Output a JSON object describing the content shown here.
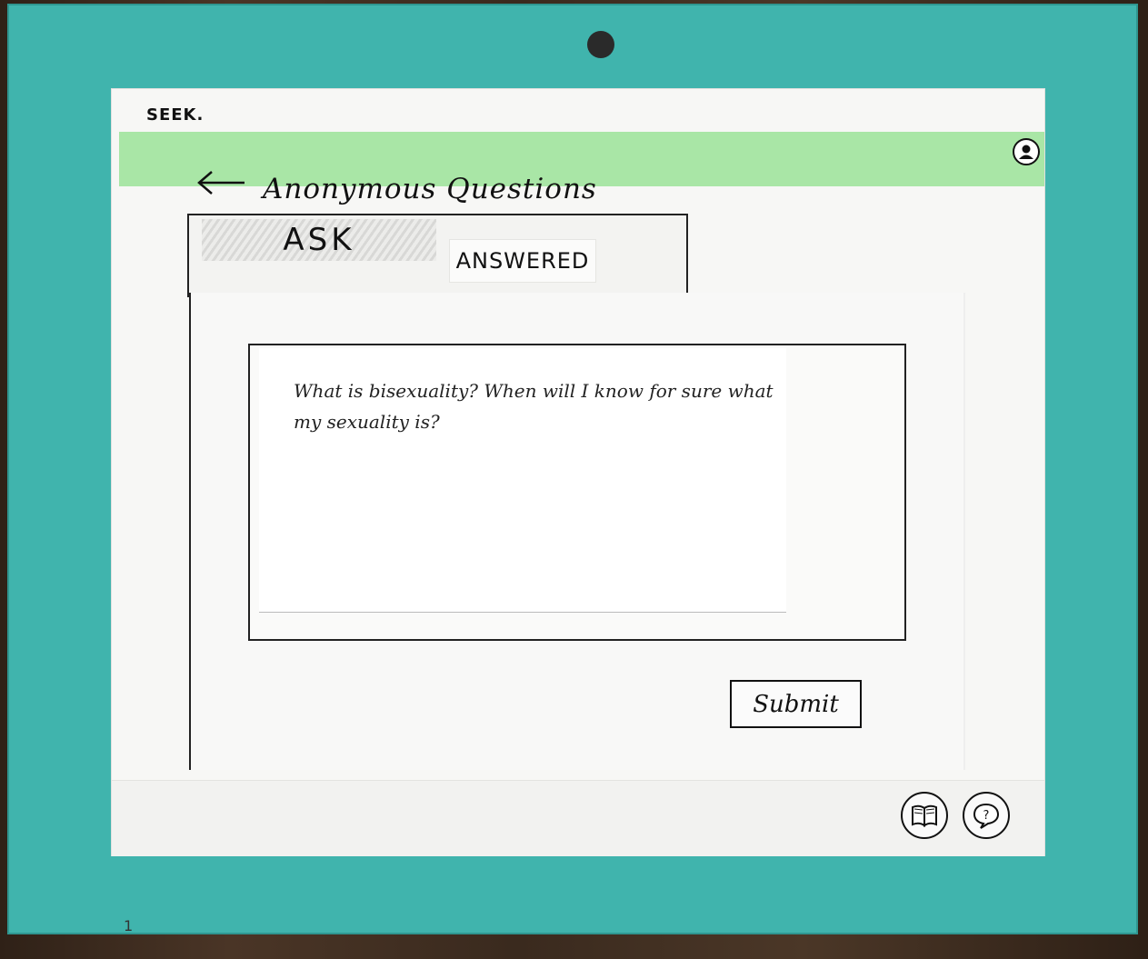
{
  "app": {
    "brand": "SEEK."
  },
  "header": {
    "back_icon": "back-arrow-icon",
    "title": "Anonymous Questions"
  },
  "tabs": [
    {
      "label": "ASK",
      "selected": true
    },
    {
      "label": "ANSWERED",
      "selected": false
    }
  ],
  "question": {
    "text": "What is bisexuality? When will I know for sure what my sexuality is?"
  },
  "actions": {
    "submit_label": "Submit"
  },
  "bottom_nav": {
    "items": [
      "book-icon",
      "question-bubble-icon"
    ]
  },
  "colors": {
    "board": "#40b4ad",
    "topbar": "#a9e6a6",
    "screen": "#f7f7f5"
  },
  "corner_mark": "1"
}
